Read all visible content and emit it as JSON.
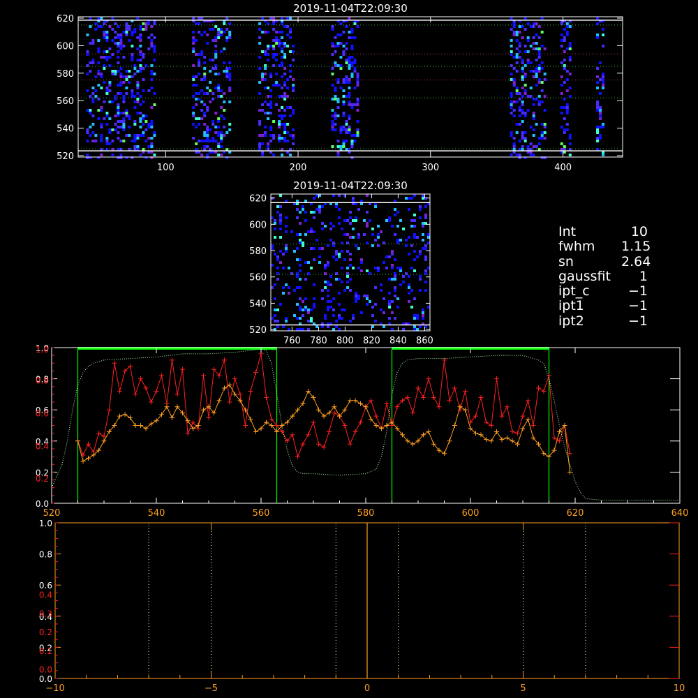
{
  "colors": {
    "background": "#000000",
    "axes": "#ffffff",
    "red": "#ff2020",
    "orange": "#ffa020",
    "green": "#00ff00",
    "raster": [
      "#1010ff",
      "#4a2cff",
      "#8020d0",
      "#20c0ff",
      "#40ffd0",
      "#60ff60"
    ]
  },
  "info": [
    {
      "key": "Int",
      "value": "10"
    },
    {
      "key": "fwhm",
      "value": "1.15"
    },
    {
      "key": "sn",
      "value": "2.64"
    },
    {
      "key": "gaussfit",
      "value": "1"
    },
    {
      "key": "ipt_c",
      "value": "−1"
    },
    {
      "key": "ipt1",
      "value": "−1"
    },
    {
      "key": "ipt2",
      "value": "−1"
    }
  ],
  "chart_data": [
    {
      "type": "heatmap",
      "title": "2019-11-04T22:09:30",
      "xlim": [
        34,
        445
      ],
      "ylim": [
        519,
        621
      ],
      "xticks": [
        100,
        200,
        300,
        400
      ],
      "yticks": [
        520,
        540,
        560,
        580,
        600,
        620
      ],
      "hlines_white": [
        523.5,
        618.5
      ],
      "hlines_green": [
        525,
        562,
        585,
        615
      ],
      "hlines_red": [
        594,
        575
      ],
      "bands": [
        [
          40,
          92
        ],
        [
          120,
          148
        ],
        [
          170,
          196
        ],
        [
          225,
          246
        ],
        [
          360,
          386
        ],
        [
          398,
          406
        ],
        [
          425,
          430
        ]
      ]
    },
    {
      "type": "heatmap",
      "title": "2019-11-04T22:09:30",
      "xlim": [
        744,
        864
      ],
      "ylim": [
        519,
        623
      ],
      "xticks": [
        760,
        780,
        800,
        820,
        840,
        860
      ],
      "yticks": [
        520,
        540,
        560,
        580,
        600,
        620
      ],
      "hlines_white": [
        523.5,
        616.5
      ],
      "hlines_green": [
        585,
        562
      ]
    },
    {
      "type": "line",
      "xlim": [
        520,
        640
      ],
      "ylim": [
        0,
        1
      ],
      "xticks": [
        520,
        540,
        560,
        580,
        600,
        620,
        640
      ],
      "yticks": [
        0.0,
        0.2,
        0.4,
        0.6,
        0.8,
        1.0
      ],
      "yticks_white": [
        "0.0",
        "0.2",
        "0.4",
        "0.6",
        "0.8",
        "1.0"
      ],
      "yticks_red": [
        "0.2",
        "0.4",
        "0.6",
        "0.8",
        "1.0"
      ],
      "green_boxes": [
        [
          525,
          563
        ],
        [
          585,
          615
        ]
      ],
      "series": [
        {
          "color": "red",
          "x": [
            525,
            526,
            527,
            528,
            529,
            530,
            531,
            532,
            533,
            534,
            535,
            536,
            537,
            538,
            539,
            540,
            541,
            542,
            543,
            544,
            545,
            546,
            547,
            548,
            549,
            550,
            551,
            552,
            553,
            554,
            555,
            556,
            557,
            558,
            559,
            560,
            561,
            562,
            563,
            564,
            565,
            566,
            567,
            568,
            569,
            570,
            571,
            572,
            573,
            574,
            575,
            576,
            577,
            578,
            579,
            580,
            581,
            582,
            583,
            584,
            585,
            586,
            587,
            588,
            589,
            590,
            591,
            592,
            593,
            594,
            595,
            596,
            597,
            598,
            599,
            600,
            601,
            602,
            603,
            604,
            605,
            606,
            607,
            608,
            609,
            610,
            611,
            612,
            613,
            614,
            615,
            616,
            617,
            618,
            619
          ],
          "y": [
            0.4,
            0.31,
            0.38,
            0.33,
            0.45,
            0.43,
            0.6,
            0.9,
            0.72,
            0.85,
            0.88,
            0.7,
            0.8,
            0.74,
            0.65,
            0.72,
            0.82,
            0.64,
            0.92,
            0.7,
            0.86,
            0.45,
            0.52,
            0.48,
            0.82,
            0.55,
            0.86,
            0.82,
            0.92,
            0.65,
            0.8,
            0.7,
            0.5,
            0.72,
            0.84,
            0.96,
            0.68,
            0.54,
            0.5,
            0.46,
            0.4,
            0.44,
            0.3,
            0.38,
            0.44,
            0.52,
            0.38,
            0.36,
            0.46,
            0.58,
            0.56,
            0.5,
            0.38,
            0.46,
            0.52,
            0.62,
            0.66,
            0.56,
            0.48,
            0.64,
            0.5,
            0.62,
            0.66,
            0.68,
            0.58,
            0.74,
            0.68,
            0.8,
            0.68,
            0.62,
            0.92,
            0.66,
            0.74,
            0.6,
            0.72,
            0.52,
            0.56,
            0.68,
            0.52,
            0.5,
            0.8,
            0.56,
            0.62,
            0.46,
            0.45,
            0.56,
            0.66,
            0.5,
            0.74,
            0.72,
            0.82,
            0.42,
            0.4,
            0.5,
            0.32
          ]
        },
        {
          "color": "orange",
          "x": [
            525,
            526,
            527,
            528,
            529,
            530,
            531,
            532,
            533,
            534,
            535,
            536,
            537,
            538,
            539,
            540,
            541,
            542,
            543,
            544,
            545,
            546,
            547,
            548,
            549,
            550,
            551,
            552,
            553,
            554,
            555,
            556,
            557,
            558,
            559,
            560,
            561,
            562,
            563,
            564,
            565,
            566,
            567,
            568,
            569,
            570,
            571,
            572,
            573,
            574,
            575,
            576,
            577,
            578,
            579,
            580,
            581,
            582,
            583,
            584,
            585,
            586,
            587,
            588,
            589,
            590,
            591,
            592,
            593,
            594,
            595,
            596,
            597,
            598,
            599,
            600,
            601,
            602,
            603,
            604,
            605,
            606,
            607,
            608,
            609,
            610,
            611,
            612,
            613,
            614,
            615,
            616,
            617,
            618,
            619
          ],
          "y": [
            0.4,
            0.27,
            0.29,
            0.31,
            0.34,
            0.4,
            0.46,
            0.5,
            0.56,
            0.57,
            0.55,
            0.5,
            0.5,
            0.48,
            0.51,
            0.53,
            0.57,
            0.62,
            0.55,
            0.62,
            0.58,
            0.53,
            0.48,
            0.5,
            0.6,
            0.62,
            0.58,
            0.66,
            0.74,
            0.76,
            0.7,
            0.66,
            0.6,
            0.54,
            0.46,
            0.48,
            0.52,
            0.5,
            0.46,
            0.5,
            0.52,
            0.56,
            0.6,
            0.64,
            0.72,
            0.68,
            0.6,
            0.56,
            0.58,
            0.62,
            0.56,
            0.6,
            0.66,
            0.66,
            0.64,
            0.62,
            0.54,
            0.5,
            0.48,
            0.5,
            0.52,
            0.48,
            0.44,
            0.4,
            0.38,
            0.4,
            0.44,
            0.46,
            0.38,
            0.34,
            0.32,
            0.4,
            0.5,
            0.62,
            0.6,
            0.48,
            0.45,
            0.44,
            0.41,
            0.4,
            0.46,
            0.41,
            0.42,
            0.4,
            0.38,
            0.48,
            0.54,
            0.42,
            0.38,
            0.32,
            0.3,
            0.34,
            0.46,
            0.5,
            0.2
          ]
        },
        {
          "color": "green",
          "style": "dotted",
          "x": [
            520,
            522,
            523,
            524,
            525,
            526,
            527,
            528,
            530,
            535,
            540,
            545,
            550,
            555,
            560,
            561,
            562,
            563,
            564,
            565,
            566,
            567,
            568,
            570,
            575,
            580,
            582,
            583,
            584,
            585,
            586,
            587,
            588,
            590,
            595,
            600,
            605,
            610,
            612,
            613,
            614,
            615,
            616,
            617,
            618,
            619,
            620,
            621,
            622,
            625,
            630,
            635,
            640
          ],
          "y": [
            0.1,
            0.25,
            0.4,
            0.6,
            0.76,
            0.84,
            0.88,
            0.9,
            0.92,
            0.93,
            0.94,
            0.96,
            0.96,
            0.97,
            0.99,
            0.98,
            0.9,
            0.7,
            0.5,
            0.34,
            0.24,
            0.2,
            0.19,
            0.19,
            0.18,
            0.19,
            0.22,
            0.3,
            0.46,
            0.7,
            0.84,
            0.9,
            0.92,
            0.93,
            0.93,
            0.94,
            0.95,
            0.95,
            0.93,
            0.92,
            0.9,
            0.8,
            0.66,
            0.5,
            0.36,
            0.25,
            0.14,
            0.07,
            0.03,
            0.02,
            0.02,
            0.02,
            0.02
          ]
        }
      ]
    },
    {
      "type": "line",
      "xlim": [
        -10,
        10
      ],
      "ylim": [
        0,
        1
      ],
      "xticks": [
        -10,
        -5,
        0,
        5,
        10
      ],
      "yticks": [
        0.0,
        0.2,
        0.4,
        0.6,
        0.8,
        1.0
      ],
      "yticks_white": [
        "0.0",
        "0.2",
        "0.4",
        "0.6",
        "0.8",
        "1.0"
      ],
      "yticks_red": [
        "0.0",
        "0.1",
        "0.2",
        "0.3",
        "0.4"
      ],
      "vlines_dotted": [
        -7,
        -5,
        -1,
        1,
        5,
        7
      ],
      "vline_orange": 0
    }
  ]
}
